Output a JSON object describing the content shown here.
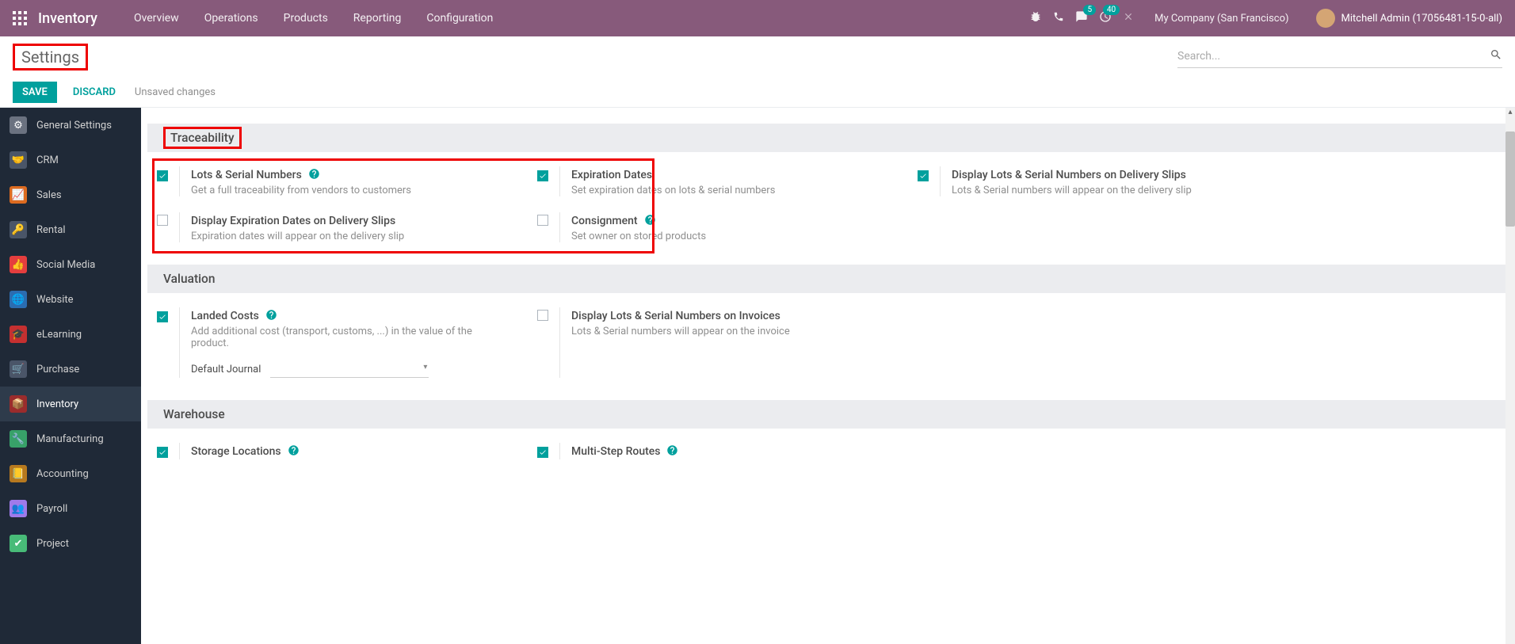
{
  "topnav": {
    "brand": "Inventory",
    "menu": [
      "Overview",
      "Operations",
      "Products",
      "Reporting",
      "Configuration"
    ],
    "messages_badge": "5",
    "activities_badge": "40",
    "company": "My Company (San Francisco)",
    "user": "Mitchell Admin (17056481-15-0-all)"
  },
  "control": {
    "title": "Settings",
    "search_placeholder": "Search..."
  },
  "actions": {
    "save": "SAVE",
    "discard": "DISCARD",
    "unsaved": "Unsaved changes"
  },
  "sidebar": [
    {
      "label": "General Settings",
      "color": "#6b7280"
    },
    {
      "label": "CRM",
      "color": "#4a5568"
    },
    {
      "label": "Sales",
      "color": "#dd6b20"
    },
    {
      "label": "Rental",
      "color": "#4a5568"
    },
    {
      "label": "Social Media",
      "color": "#e53e3e"
    },
    {
      "label": "Website",
      "color": "#2b6cb0"
    },
    {
      "label": "eLearning",
      "color": "#c53030"
    },
    {
      "label": "Purchase",
      "color": "#4a5568"
    },
    {
      "label": "Inventory",
      "color": "#9b2c2c",
      "active": true
    },
    {
      "label": "Manufacturing",
      "color": "#38a169"
    },
    {
      "label": "Accounting",
      "color": "#b7791f"
    },
    {
      "label": "Payroll",
      "color": "#9f7aea"
    },
    {
      "label": "Project",
      "color": "#48bb78"
    }
  ],
  "sections": {
    "traceability": {
      "header": "Traceability",
      "lots": {
        "title": "Lots & Serial Numbers",
        "desc": "Get a full traceability from vendors to customers",
        "checked": true,
        "help": true
      },
      "expiration": {
        "title": "Expiration Dates",
        "desc": "Set expiration dates on lots & serial numbers",
        "checked": true
      },
      "display_lots_slip": {
        "title": "Display Lots & Serial Numbers on Delivery Slips",
        "desc": "Lots & Serial numbers will appear on the delivery slip",
        "checked": true
      },
      "display_exp_slip": {
        "title": "Display Expiration Dates on Delivery Slips",
        "desc": "Expiration dates will appear on the delivery slip",
        "checked": false
      },
      "consignment": {
        "title": "Consignment",
        "desc": "Set owner on stored products",
        "checked": false,
        "help": true
      }
    },
    "valuation": {
      "header": "Valuation",
      "landed": {
        "title": "Landed Costs",
        "desc": "Add additional cost (transport, customs, ...) in the value of the product.",
        "checked": true,
        "help": true,
        "journal_label": "Default Journal"
      },
      "display_lots_inv": {
        "title": "Display Lots & Serial Numbers on Invoices",
        "desc": "Lots & Serial numbers will appear on the invoice",
        "checked": false
      }
    },
    "warehouse": {
      "header": "Warehouse",
      "storage": {
        "title": "Storage Locations",
        "checked": true,
        "help": true
      },
      "multistep": {
        "title": "Multi-Step Routes",
        "checked": true,
        "help": true
      }
    }
  }
}
